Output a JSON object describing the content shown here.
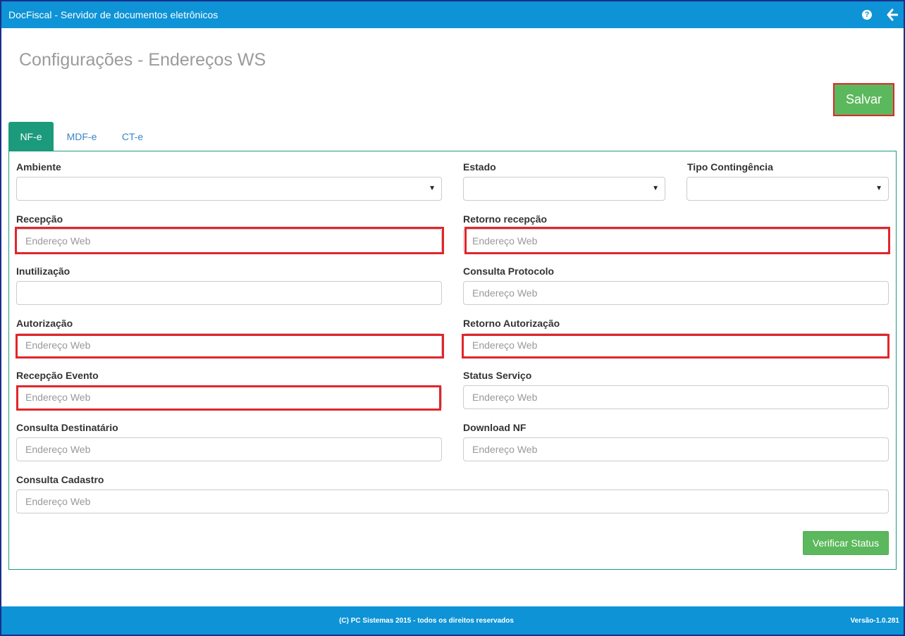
{
  "app": {
    "title": "DocFiscal - Servidor de documentos eletrônicos"
  },
  "icons": {
    "help": "question-circle-icon",
    "back": "arrow-left-icon"
  },
  "page": {
    "title": "Configurações - Endereços WS"
  },
  "toolbar": {
    "save_label": "Salvar"
  },
  "tabs": [
    {
      "label": "NF-e",
      "active": true
    },
    {
      "label": "MDF-e",
      "active": false
    },
    {
      "label": "CT-e",
      "active": false
    }
  ],
  "form": {
    "ambiente": {
      "label": "Ambiente",
      "value": ""
    },
    "estado": {
      "label": "Estado",
      "value": ""
    },
    "tipo_contingencia": {
      "label": "Tipo Contingência",
      "value": ""
    },
    "recepcao": {
      "label": "Recepção",
      "placeholder": "Endereço Web",
      "value": ""
    },
    "retorno_recepcao": {
      "label": "Retorno recepção",
      "placeholder": "Endereço Web",
      "value": ""
    },
    "inutilizacao": {
      "label": "Inutilização",
      "placeholder": "",
      "value": ""
    },
    "consulta_protocolo": {
      "label": "Consulta Protocolo",
      "placeholder": "Endereço Web",
      "value": ""
    },
    "autorizacao": {
      "label": "Autorização",
      "placeholder": "Endereço Web",
      "value": ""
    },
    "retorno_autorizacao": {
      "label": "Retorno Autorização",
      "placeholder": "Endereço Web",
      "value": ""
    },
    "recepcao_evento": {
      "label": "Recepção Evento",
      "placeholder": "Endereço Web",
      "value": ""
    },
    "status_servico": {
      "label": "Status Serviço",
      "placeholder": "Endereço Web",
      "value": ""
    },
    "consulta_destinatario": {
      "label": "Consulta Destinatário",
      "placeholder": "Endereço Web",
      "value": ""
    },
    "download_nf": {
      "label": "Download NF",
      "placeholder": "Endereço Web",
      "value": ""
    },
    "consulta_cadastro": {
      "label": "Consulta Cadastro",
      "placeholder": "Endereço Web",
      "value": ""
    },
    "verify_label": "Verificar Status"
  },
  "footer": {
    "copyright": "(C) PC Sistemas 2015 - todos os direitos reservados",
    "version": "Versão-1.0.281"
  },
  "colors": {
    "brand": "#0d93d6",
    "tab_active": "#1b9a7c",
    "success": "#5cb85c",
    "highlight": "#e0262b"
  }
}
